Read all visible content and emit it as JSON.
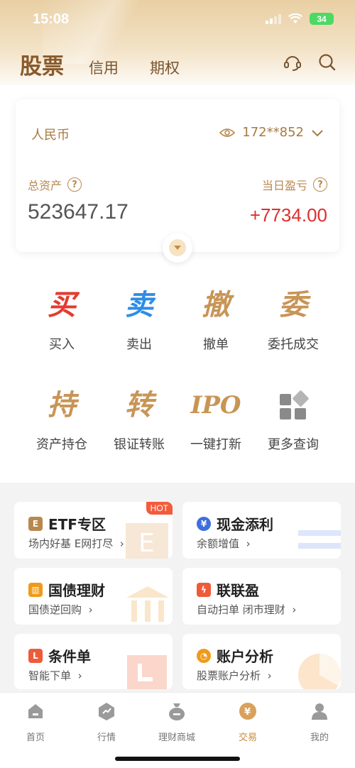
{
  "status": {
    "time": "15:08",
    "battery": "34"
  },
  "header": {
    "main_tab": "股票",
    "tabs": [
      "信用",
      "期权"
    ]
  },
  "account": {
    "currency": "人民币",
    "account_no": "172**852",
    "total_assets_label": "总资产",
    "total_assets_value": "523647.17",
    "daily_pnl_label": "当日盈亏",
    "daily_pnl_value": "+7734.00",
    "help_glyph": "?"
  },
  "actions": [
    {
      "glyph": "买",
      "label": "买入",
      "color": "#e53b2f"
    },
    {
      "glyph": "卖",
      "label": "卖出",
      "color": "#2d8de8"
    },
    {
      "glyph": "撤",
      "label": "撤单",
      "color": "#c89556"
    },
    {
      "glyph": "委",
      "label": "委托成交",
      "color": "#c89556"
    },
    {
      "glyph": "持",
      "label": "资产持仓",
      "color": "#c89556"
    },
    {
      "glyph": "转",
      "label": "银证转账",
      "color": "#c89556"
    },
    {
      "glyph": "IPO",
      "label": "一键打新",
      "color": "#c89556"
    },
    {
      "glyph": "",
      "label": "更多查询",
      "color": "#8a8a8a"
    }
  ],
  "promos": [
    {
      "title": "ETF专区",
      "sub": "场内好基 E网打尽",
      "icon": "E",
      "icon_color": "#b8894f",
      "hot": "HOT"
    },
    {
      "title": "现金添利",
      "sub": "余额增值",
      "icon": "¥",
      "icon_color": "#3c6fe0"
    },
    {
      "title": "国债理财",
      "sub": "国债逆回购",
      "icon": "▥",
      "icon_color": "#f09a1a"
    },
    {
      "title": "联联盈",
      "sub": "自动扫单 闭市理财",
      "icon": "ϟ",
      "icon_color": "#ef5b3a"
    },
    {
      "title": "条件单",
      "sub": "智能下单",
      "icon": "L",
      "icon_color": "#ef5b3a"
    },
    {
      "title": "账户分析",
      "sub": "股票账户分析",
      "icon": "◔",
      "icon_color": "#f09a1a"
    }
  ],
  "bottom_nav": [
    {
      "label": "首页"
    },
    {
      "label": "行情"
    },
    {
      "label": "理财商城"
    },
    {
      "label": "交易",
      "active": true
    },
    {
      "label": "我的"
    }
  ]
}
